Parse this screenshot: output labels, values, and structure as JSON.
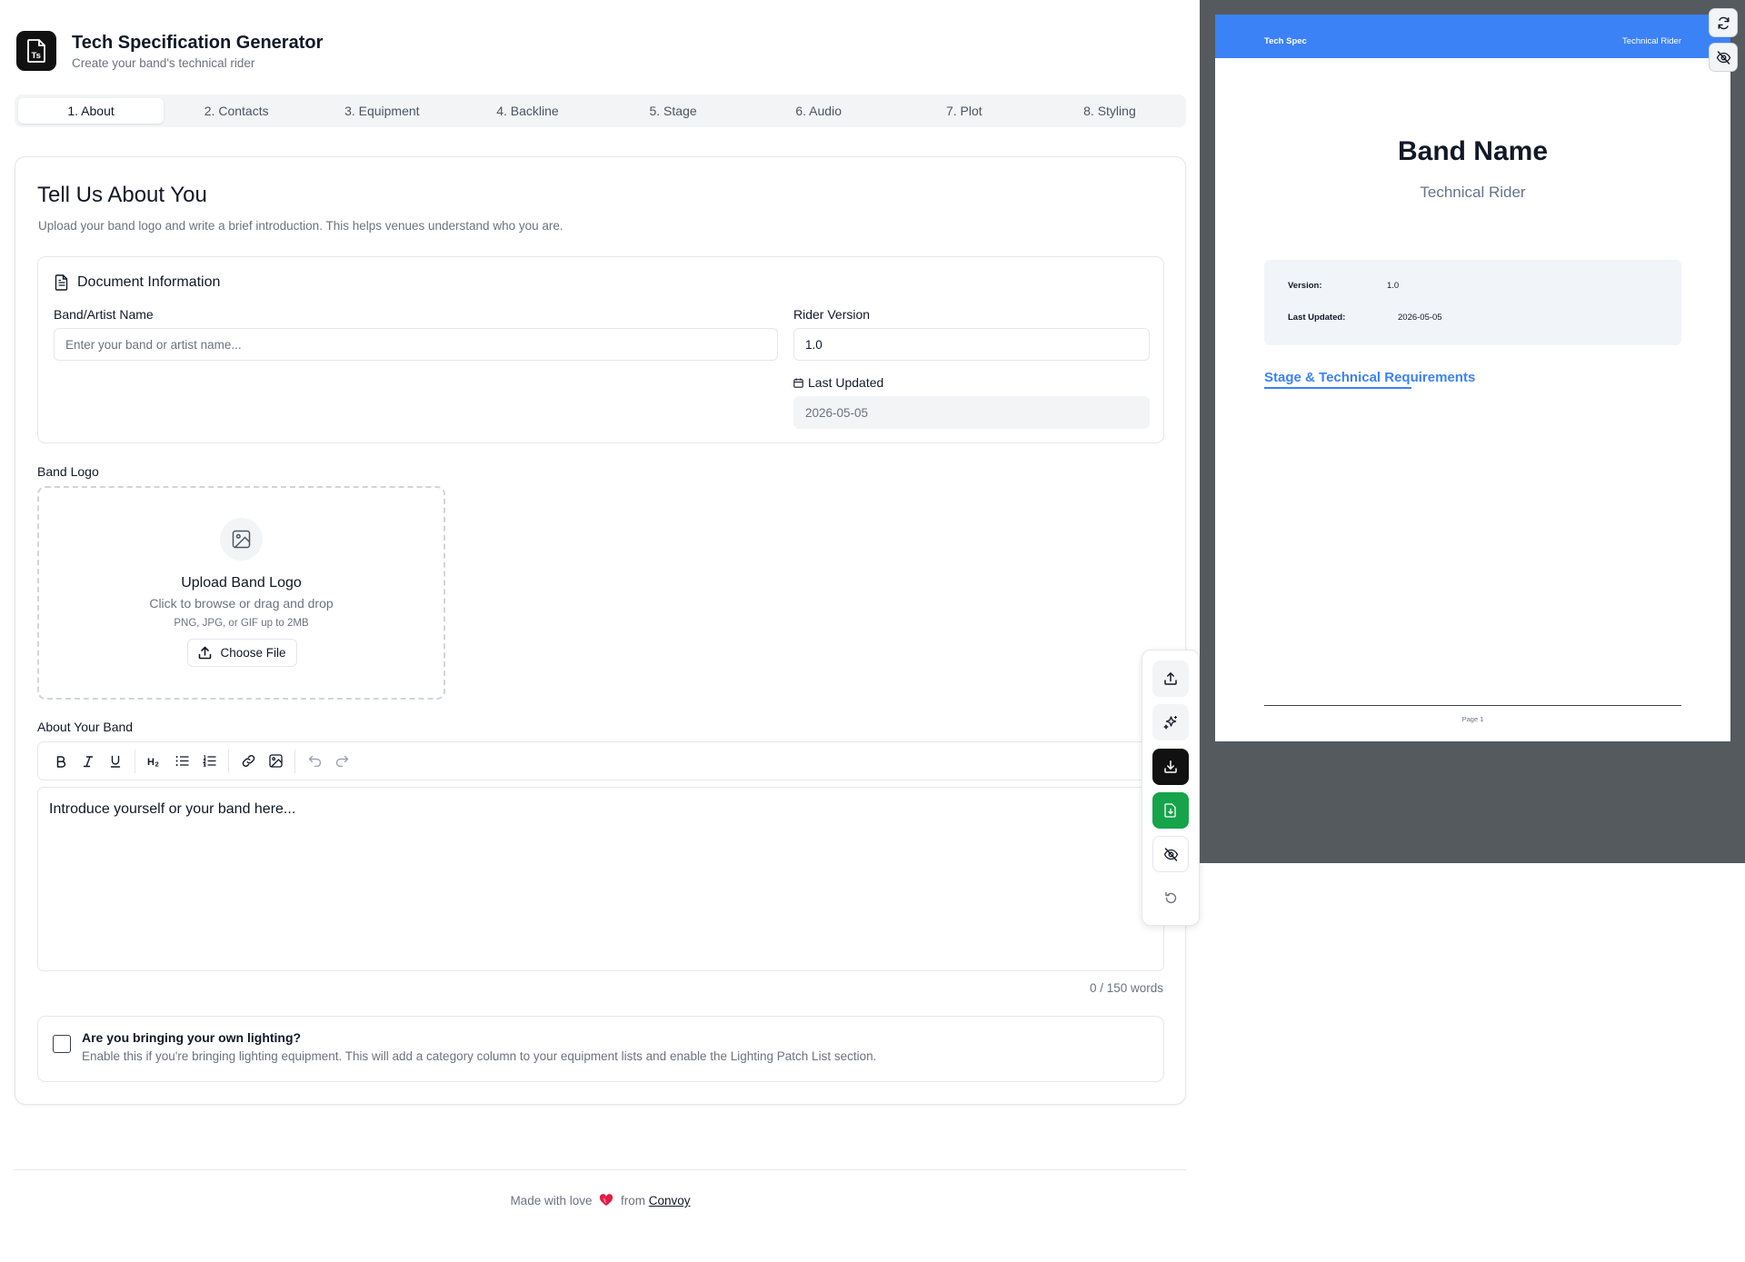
{
  "app": {
    "title": "Tech Specification Generator",
    "subtitle": "Create your band's technical rider",
    "logo_icon": "document-ts-icon"
  },
  "tabs": [
    {
      "label": "1. About",
      "active": true
    },
    {
      "label": "2. Contacts",
      "active": false
    },
    {
      "label": "3. Equipment",
      "active": false
    },
    {
      "label": "4. Backline",
      "active": false
    },
    {
      "label": "5. Stage",
      "active": false
    },
    {
      "label": "6. Audio",
      "active": false
    },
    {
      "label": "7. Plot",
      "active": false
    },
    {
      "label": "8. Styling",
      "active": false
    }
  ],
  "about": {
    "title": "Tell Us About You",
    "description": "Upload your band logo and write a brief introduction. This helps venues understand who you are.",
    "doc_info": {
      "heading": "Document Information",
      "band_name_label": "Band/Artist Name",
      "band_name_placeholder": "Enter your band or artist name...",
      "band_name_value": "",
      "rider_version_label": "Rider Version",
      "rider_version_value": "1.0",
      "last_updated_label": "Last Updated",
      "last_updated_value": "2026-05-05"
    },
    "logo": {
      "label": "Band Logo",
      "upload_title": "Upload Band Logo",
      "upload_subtitle": "Click to browse or drag and drop",
      "upload_hint": "PNG, JPG, or GIF up to 2MB",
      "choose_button": "Choose File"
    },
    "about_band": {
      "label": "About Your Band",
      "placeholder": "Introduce yourself or your band here...",
      "word_count": "0 / 150 words",
      "toolbar": [
        "bold",
        "italic",
        "underline",
        "heading-2",
        "bullet-list",
        "ordered-list",
        "link",
        "image",
        "undo",
        "redo"
      ]
    },
    "lighting": {
      "title": "Are you bringing your own lighting?",
      "description": "Enable this if you're bringing lighting equipment. This will add a category column to your equipment lists and enable the Lighting Patch List section.",
      "checked": false
    }
  },
  "float_actions": [
    "upload-icon",
    "sparkles-icon",
    "download-icon",
    "file-export-icon",
    "eye-off-icon",
    "reset-icon"
  ],
  "footer": {
    "prefix": "Made with love",
    "middle": "from",
    "link": "Convoy"
  },
  "preview": {
    "header_left": "Tech Spec",
    "header_right": "Technical Rider",
    "band_name": "Band Name",
    "subtitle": "Technical Rider",
    "version_label": "Version:",
    "version_value": "1.0",
    "updated_label": "Last Updated:",
    "updated_value": "2026-05-05",
    "section_title": "Stage & Technical Requirements",
    "page_label": "Page 1",
    "accent_color": "#3b82f6"
  }
}
